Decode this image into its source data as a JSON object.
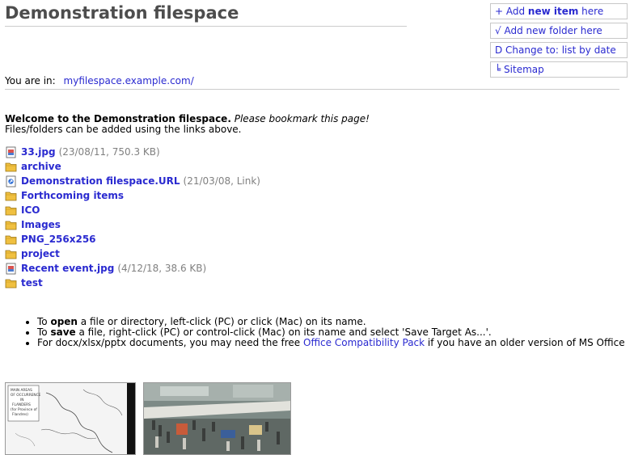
{
  "page": {
    "title": "Demonstration filespace"
  },
  "actions": [
    {
      "pre": "+ Add ",
      "mid": "new item",
      "post": " here"
    },
    {
      "pre": "√ Add new folder here",
      "mid": "",
      "post": ""
    },
    {
      "pre": "D Change to: list by date",
      "mid": "",
      "post": ""
    },
    {
      "pre": "╘ Sitemap",
      "mid": "",
      "post": ""
    }
  ],
  "location": {
    "label": "You are in:",
    "url": "myfilespace.example.com/"
  },
  "intro": {
    "welcome": "Welcome to the Demonstration filespace.",
    "bookmark": "Please bookmark this page!",
    "instructions": "Files/folders can be added using the links above."
  },
  "files": [
    {
      "icon": "image-file-icon",
      "name": "33.jpg",
      "meta": "(23/08/11, 750.3 KB)"
    },
    {
      "icon": "folder-icon",
      "name": "archive",
      "meta": ""
    },
    {
      "icon": "link-file-icon",
      "name": "Demonstration filespace.URL",
      "meta": "(21/03/08, Link)"
    },
    {
      "icon": "folder-icon",
      "name": "Forthcoming items",
      "meta": ""
    },
    {
      "icon": "folder-icon",
      "name": "ICO",
      "meta": ""
    },
    {
      "icon": "folder-icon",
      "name": "Images",
      "meta": ""
    },
    {
      "icon": "folder-icon",
      "name": "PNG_256x256",
      "meta": ""
    },
    {
      "icon": "folder-icon",
      "name": "project",
      "meta": ""
    },
    {
      "icon": "image-file-icon",
      "name": "Recent event.jpg",
      "meta": "(4/12/18, 38.6 KB)"
    },
    {
      "icon": "folder-icon",
      "name": "test",
      "meta": ""
    }
  ],
  "tips": {
    "tip1": {
      "a": "To ",
      "b": "open",
      "c": " a file or directory, left-click (PC) or click (Mac) on its name."
    },
    "tip2": {
      "a": "To ",
      "b": "save",
      "c": " a file, right-click (PC) or control-click (Mac) on its name and select 'Save Target As...'."
    },
    "tip3": {
      "a": "For docx/xlsx/pptx documents, you may need the free ",
      "link": "Office Compatibility Pack",
      "c": " if you have an older version of MS Office"
    }
  },
  "thumbnails": {
    "map_lines": [
      "MAIN AREAS",
      "OF OCCURRENCE",
      "IN",
      "FLANDERS",
      "(for Province of",
      "Flandres)"
    ]
  },
  "colors": {
    "link": "#2a2ad0",
    "title": "#4d4d4d",
    "meta": "#808080",
    "folder": "#f0c040"
  }
}
